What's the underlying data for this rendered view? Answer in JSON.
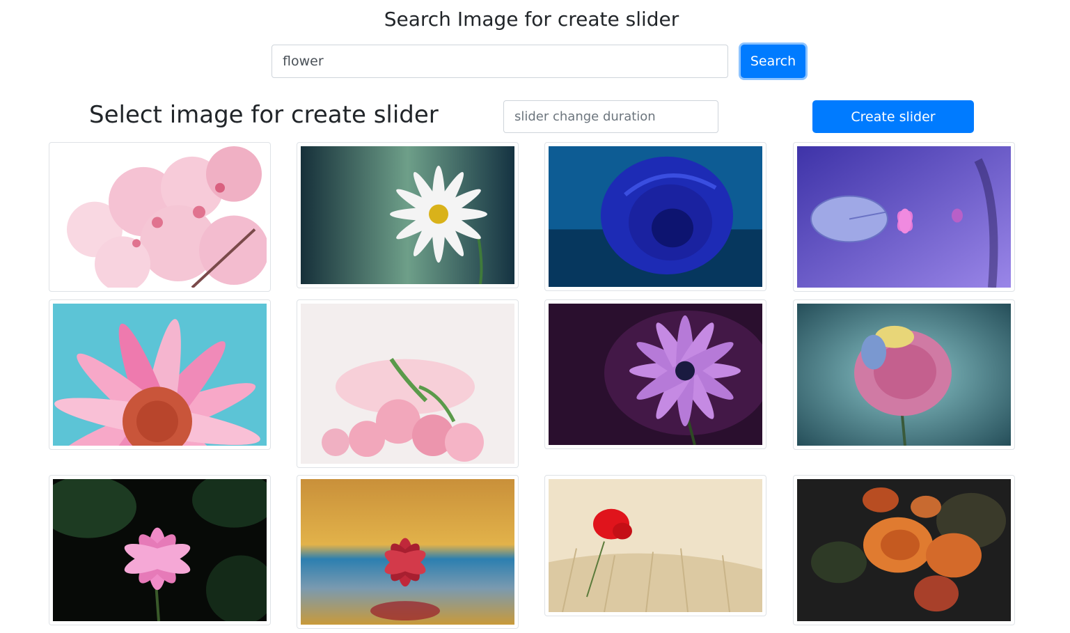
{
  "header": {
    "title": "Search Image for create slider"
  },
  "search": {
    "value": "flower",
    "button_label": "Search"
  },
  "slider": {
    "subtitle": "Select image for create slider",
    "duration_placeholder": "slider change duration",
    "create_label": "Create slider"
  },
  "images": [
    {
      "subject": "pink cherry blossoms",
      "colors": [
        "#ffffff",
        "#f7c6d6",
        "#e8849f"
      ]
    },
    {
      "subject": "white daisy",
      "colors": [
        "#1b3a45",
        "#6fa08a",
        "#ffffff"
      ]
    },
    {
      "subject": "blue rose",
      "colors": [
        "#0a4f8a",
        "#1f2fbf",
        "#0b1470"
      ]
    },
    {
      "subject": "lotus and lily pad on purple water",
      "colors": [
        "#5b4fc9",
        "#8a7be0",
        "#e07ad8"
      ]
    },
    {
      "subject": "pink gerbera close-up",
      "colors": [
        "#5cc4d6",
        "#f07cb0",
        "#c9553a"
      ]
    },
    {
      "subject": "pink rose bouquet",
      "colors": [
        "#f2eeee",
        "#f5c7d2",
        "#e98aa5"
      ]
    },
    {
      "subject": "purple daisy",
      "colors": [
        "#2a0f2e",
        "#6a2a6e",
        "#c58ae3"
      ]
    },
    {
      "subject": "pink rose on teal",
      "colors": [
        "#2e5f69",
        "#7fbcc0",
        "#d97aa0"
      ]
    },
    {
      "subject": "pink lotus on dark",
      "colors": [
        "#0a0f0a",
        "#1d3b22",
        "#f08cc8"
      ]
    },
    {
      "subject": "red water lily",
      "colors": [
        "#d8a43c",
        "#2c7fb0",
        "#c0283a"
      ]
    },
    {
      "subject": "red poppy in wheat",
      "colors": [
        "#efe2c8",
        "#d9c49a",
        "#e0141c"
      ]
    },
    {
      "subject": "orange roses on dark",
      "colors": [
        "#1e1e1e",
        "#3a3a2a",
        "#e07b30"
      ]
    }
  ]
}
